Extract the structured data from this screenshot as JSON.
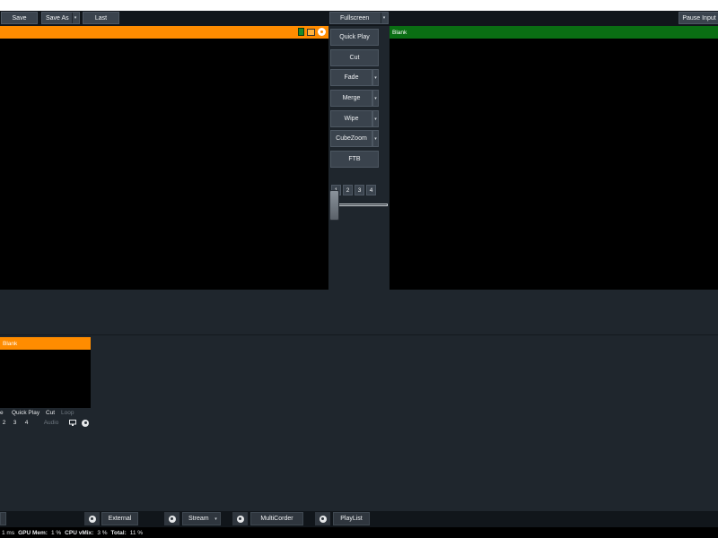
{
  "toolbar": {
    "save": "Save",
    "save_as": "Save As",
    "last": "Last",
    "fullscreen": "Fullscreen",
    "pause_input": "Pause Input",
    "dropdown_glyph": "▾"
  },
  "preview": {
    "title": ""
  },
  "output": {
    "title": "Blank"
  },
  "transitions": {
    "quick_play": "Quick Play",
    "cut": "Cut",
    "fade": "Fade",
    "merge": "Merge",
    "wipe": "Wipe",
    "cubezoom": "CubeZoom",
    "ftb": "FTB",
    "numbers": [
      "1",
      "2",
      "3",
      "4"
    ],
    "tbar_position": 0
  },
  "input_tile": {
    "title": "Blank",
    "menu": [
      "e",
      "Quick Play",
      "Cut",
      "Loop"
    ],
    "numbers": [
      "2",
      "3",
      "4"
    ],
    "audio": "Audio"
  },
  "bottom": {
    "external": "External",
    "stream": "Stream",
    "multicorder": "MultiCorder",
    "playlist": "PlayList"
  },
  "status": {
    "render_time": "1 ms",
    "gpu_mem_label": "GPU Mem:",
    "gpu_mem_value": "1 %",
    "cpu_label": "CPU vMix:",
    "cpu_value": "3 %",
    "total_label": "Total:",
    "total_value": "11 %"
  },
  "colors": {
    "preview_header": "#ff8c00",
    "output_header": "#0a6e13",
    "background": "#1f262d",
    "tbar_accent": "#1e78ff"
  }
}
